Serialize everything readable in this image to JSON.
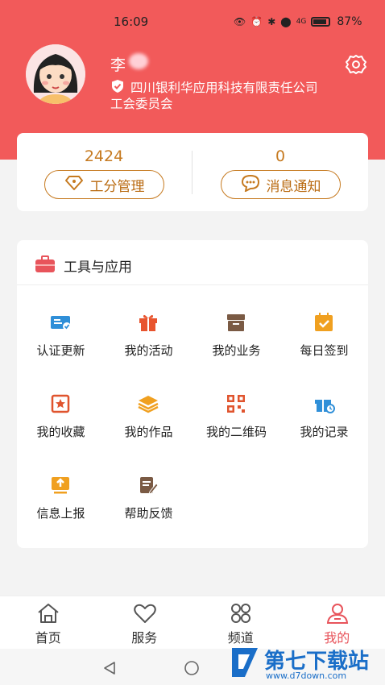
{
  "status_bar": {
    "time": "16:09",
    "battery": "87%",
    "signal_label": "4G"
  },
  "profile": {
    "name": "李",
    "org_line1": "四川银利华应用科技有限责任公司",
    "org_line2": "工会委员会"
  },
  "stats": {
    "points_value": "2424",
    "points_button": "工分管理",
    "messages_value": "0",
    "messages_button": "消息通知"
  },
  "tools": {
    "title": "工具与应用",
    "items": [
      {
        "label": "认证更新",
        "icon": "id-card-icon"
      },
      {
        "label": "我的活动",
        "icon": "gift-icon"
      },
      {
        "label": "我的业务",
        "icon": "archive-box-icon"
      },
      {
        "label": "每日签到",
        "icon": "calendar-check-icon"
      },
      {
        "label": "我的收藏",
        "icon": "star-frame-icon"
      },
      {
        "label": "我的作品",
        "icon": "layers-icon"
      },
      {
        "label": "我的二维码",
        "icon": "qr-code-icon"
      },
      {
        "label": "我的记录",
        "icon": "gift-clock-icon"
      },
      {
        "label": "信息上报",
        "icon": "upload-icon"
      },
      {
        "label": "帮助反馈",
        "icon": "edit-doc-icon"
      }
    ]
  },
  "tabbar": {
    "tabs": [
      {
        "label": "首页"
      },
      {
        "label": "服务"
      },
      {
        "label": "频道"
      },
      {
        "label": "我的"
      }
    ],
    "active_index": 3
  },
  "watermark": {
    "text": "第七下载站",
    "url": "www.d7down.com"
  },
  "colors": {
    "header": "#f25a5a",
    "accent_orange": "#c67a20",
    "active_tab": "#e8545b"
  }
}
